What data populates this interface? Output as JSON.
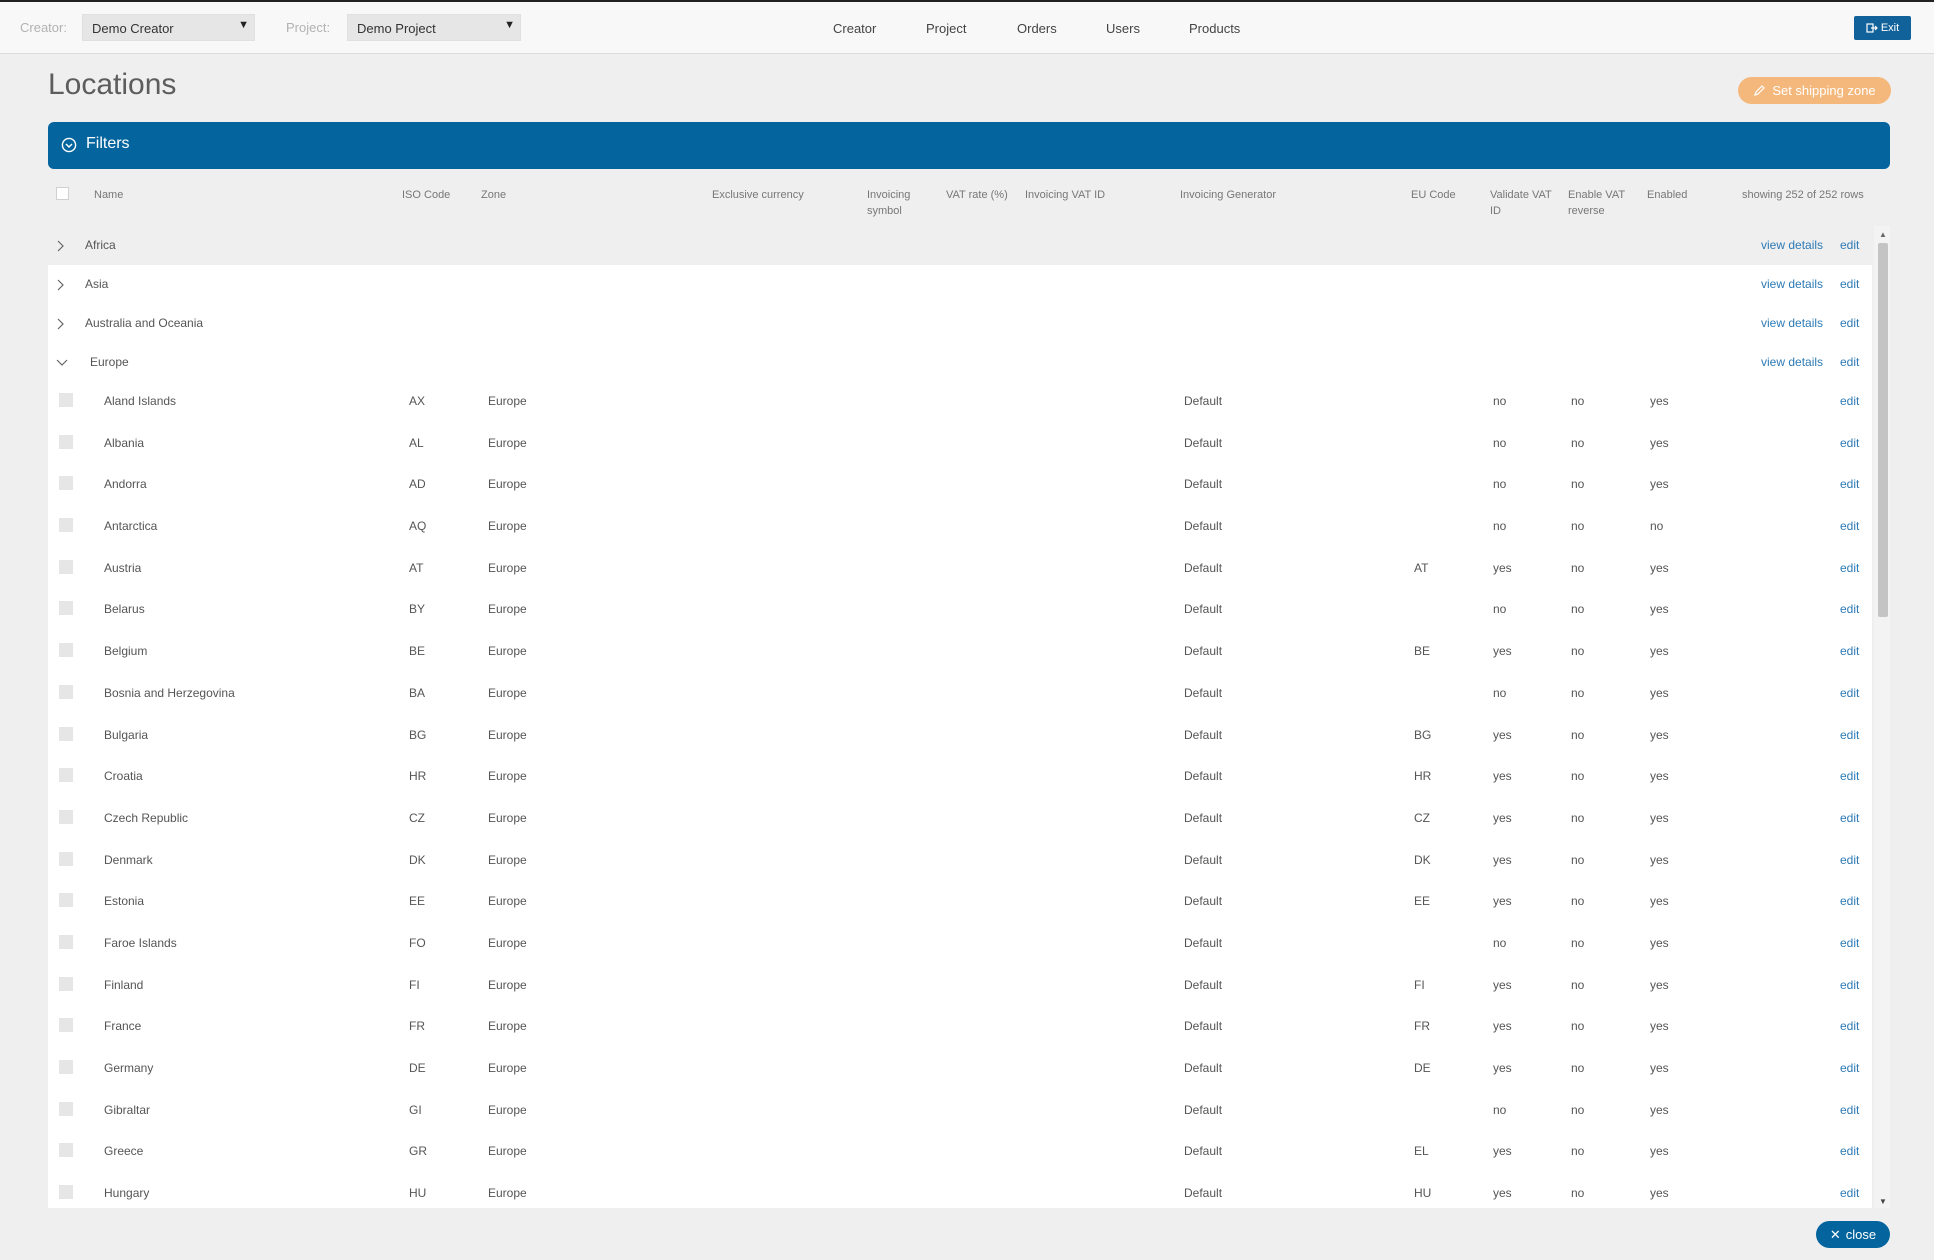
{
  "topbar": {
    "creator_label": "Creator:",
    "creator_value": "Demo Creator",
    "project_label": "Project:",
    "project_value": "Demo Project",
    "nav": [
      "Creator",
      "Project",
      "Orders",
      "Users",
      "Products"
    ],
    "exit_label": "Exit"
  },
  "page": {
    "title": "Locations",
    "ship_button": "Set shipping zone",
    "filters_label": "Filters",
    "close_label": "close"
  },
  "table": {
    "headers": {
      "name": "Name",
      "iso": "ISO Code",
      "zone": "Zone",
      "excl_currency": "Exclusive currency",
      "inv_symbol": "Invoicing symbol",
      "vat_rate": "VAT rate (%)",
      "inv_vat_id": "Invoicing VAT ID",
      "inv_generator": "Invoicing Generator",
      "eu_code": "EU Code",
      "validate_vat": "Validate VAT ID",
      "vat_reverse": "Enable VAT reverse",
      "enabled": "Enabled",
      "showing": "showing 252 of 252 rows"
    },
    "view_details_label": "view details",
    "edit_label": "edit",
    "groups": [
      {
        "name": "Africa",
        "expanded": false
      },
      {
        "name": "Asia",
        "expanded": false
      },
      {
        "name": "Australia and Oceania",
        "expanded": false
      },
      {
        "name": "Europe",
        "expanded": true
      }
    ],
    "rows": [
      {
        "name": "Aland Islands",
        "iso": "AX",
        "zone": "Europe",
        "gen": "Default",
        "eu": "",
        "validate": "no",
        "reverse": "no",
        "enabled": "yes"
      },
      {
        "name": "Albania",
        "iso": "AL",
        "zone": "Europe",
        "gen": "Default",
        "eu": "",
        "validate": "no",
        "reverse": "no",
        "enabled": "yes"
      },
      {
        "name": "Andorra",
        "iso": "AD",
        "zone": "Europe",
        "gen": "Default",
        "eu": "",
        "validate": "no",
        "reverse": "no",
        "enabled": "yes"
      },
      {
        "name": "Antarctica",
        "iso": "AQ",
        "zone": "Europe",
        "gen": "Default",
        "eu": "",
        "validate": "no",
        "reverse": "no",
        "enabled": "no"
      },
      {
        "name": "Austria",
        "iso": "AT",
        "zone": "Europe",
        "gen": "Default",
        "eu": "AT",
        "validate": "yes",
        "reverse": "no",
        "enabled": "yes"
      },
      {
        "name": "Belarus",
        "iso": "BY",
        "zone": "Europe",
        "gen": "Default",
        "eu": "",
        "validate": "no",
        "reverse": "no",
        "enabled": "yes"
      },
      {
        "name": "Belgium",
        "iso": "BE",
        "zone": "Europe",
        "gen": "Default",
        "eu": "BE",
        "validate": "yes",
        "reverse": "no",
        "enabled": "yes"
      },
      {
        "name": "Bosnia and Herzegovina",
        "iso": "BA",
        "zone": "Europe",
        "gen": "Default",
        "eu": "",
        "validate": "no",
        "reverse": "no",
        "enabled": "yes"
      },
      {
        "name": "Bulgaria",
        "iso": "BG",
        "zone": "Europe",
        "gen": "Default",
        "eu": "BG",
        "validate": "yes",
        "reverse": "no",
        "enabled": "yes"
      },
      {
        "name": "Croatia",
        "iso": "HR",
        "zone": "Europe",
        "gen": "Default",
        "eu": "HR",
        "validate": "yes",
        "reverse": "no",
        "enabled": "yes"
      },
      {
        "name": "Czech Republic",
        "iso": "CZ",
        "zone": "Europe",
        "gen": "Default",
        "eu": "CZ",
        "validate": "yes",
        "reverse": "no",
        "enabled": "yes"
      },
      {
        "name": "Denmark",
        "iso": "DK",
        "zone": "Europe",
        "gen": "Default",
        "eu": "DK",
        "validate": "yes",
        "reverse": "no",
        "enabled": "yes"
      },
      {
        "name": "Estonia",
        "iso": "EE",
        "zone": "Europe",
        "gen": "Default",
        "eu": "EE",
        "validate": "yes",
        "reverse": "no",
        "enabled": "yes"
      },
      {
        "name": "Faroe Islands",
        "iso": "FO",
        "zone": "Europe",
        "gen": "Default",
        "eu": "",
        "validate": "no",
        "reverse": "no",
        "enabled": "yes"
      },
      {
        "name": "Finland",
        "iso": "FI",
        "zone": "Europe",
        "gen": "Default",
        "eu": "FI",
        "validate": "yes",
        "reverse": "no",
        "enabled": "yes"
      },
      {
        "name": "France",
        "iso": "FR",
        "zone": "Europe",
        "gen": "Default",
        "eu": "FR",
        "validate": "yes",
        "reverse": "no",
        "enabled": "yes"
      },
      {
        "name": "Germany",
        "iso": "DE",
        "zone": "Europe",
        "gen": "Default",
        "eu": "DE",
        "validate": "yes",
        "reverse": "no",
        "enabled": "yes"
      },
      {
        "name": "Gibraltar",
        "iso": "GI",
        "zone": "Europe",
        "gen": "Default",
        "eu": "",
        "validate": "no",
        "reverse": "no",
        "enabled": "yes"
      },
      {
        "name": "Greece",
        "iso": "GR",
        "zone": "Europe",
        "gen": "Default",
        "eu": "EL",
        "validate": "yes",
        "reverse": "no",
        "enabled": "yes"
      },
      {
        "name": "Hungary",
        "iso": "HU",
        "zone": "Europe",
        "gen": "Default",
        "eu": "HU",
        "validate": "yes",
        "reverse": "no",
        "enabled": "yes"
      }
    ]
  },
  "icons": {
    "dropdown": "caret-down-icon",
    "exit": "sign-out-icon",
    "ship": "pencil-icon",
    "filters": "chevron-circle-icon",
    "expand": "chevron-right-icon",
    "collapse": "chevron-down-icon",
    "close": "times-icon"
  },
  "colors": {
    "primary": "#04649d",
    "accent_orange": "#f5b87c",
    "link": "#2d7ab5"
  }
}
